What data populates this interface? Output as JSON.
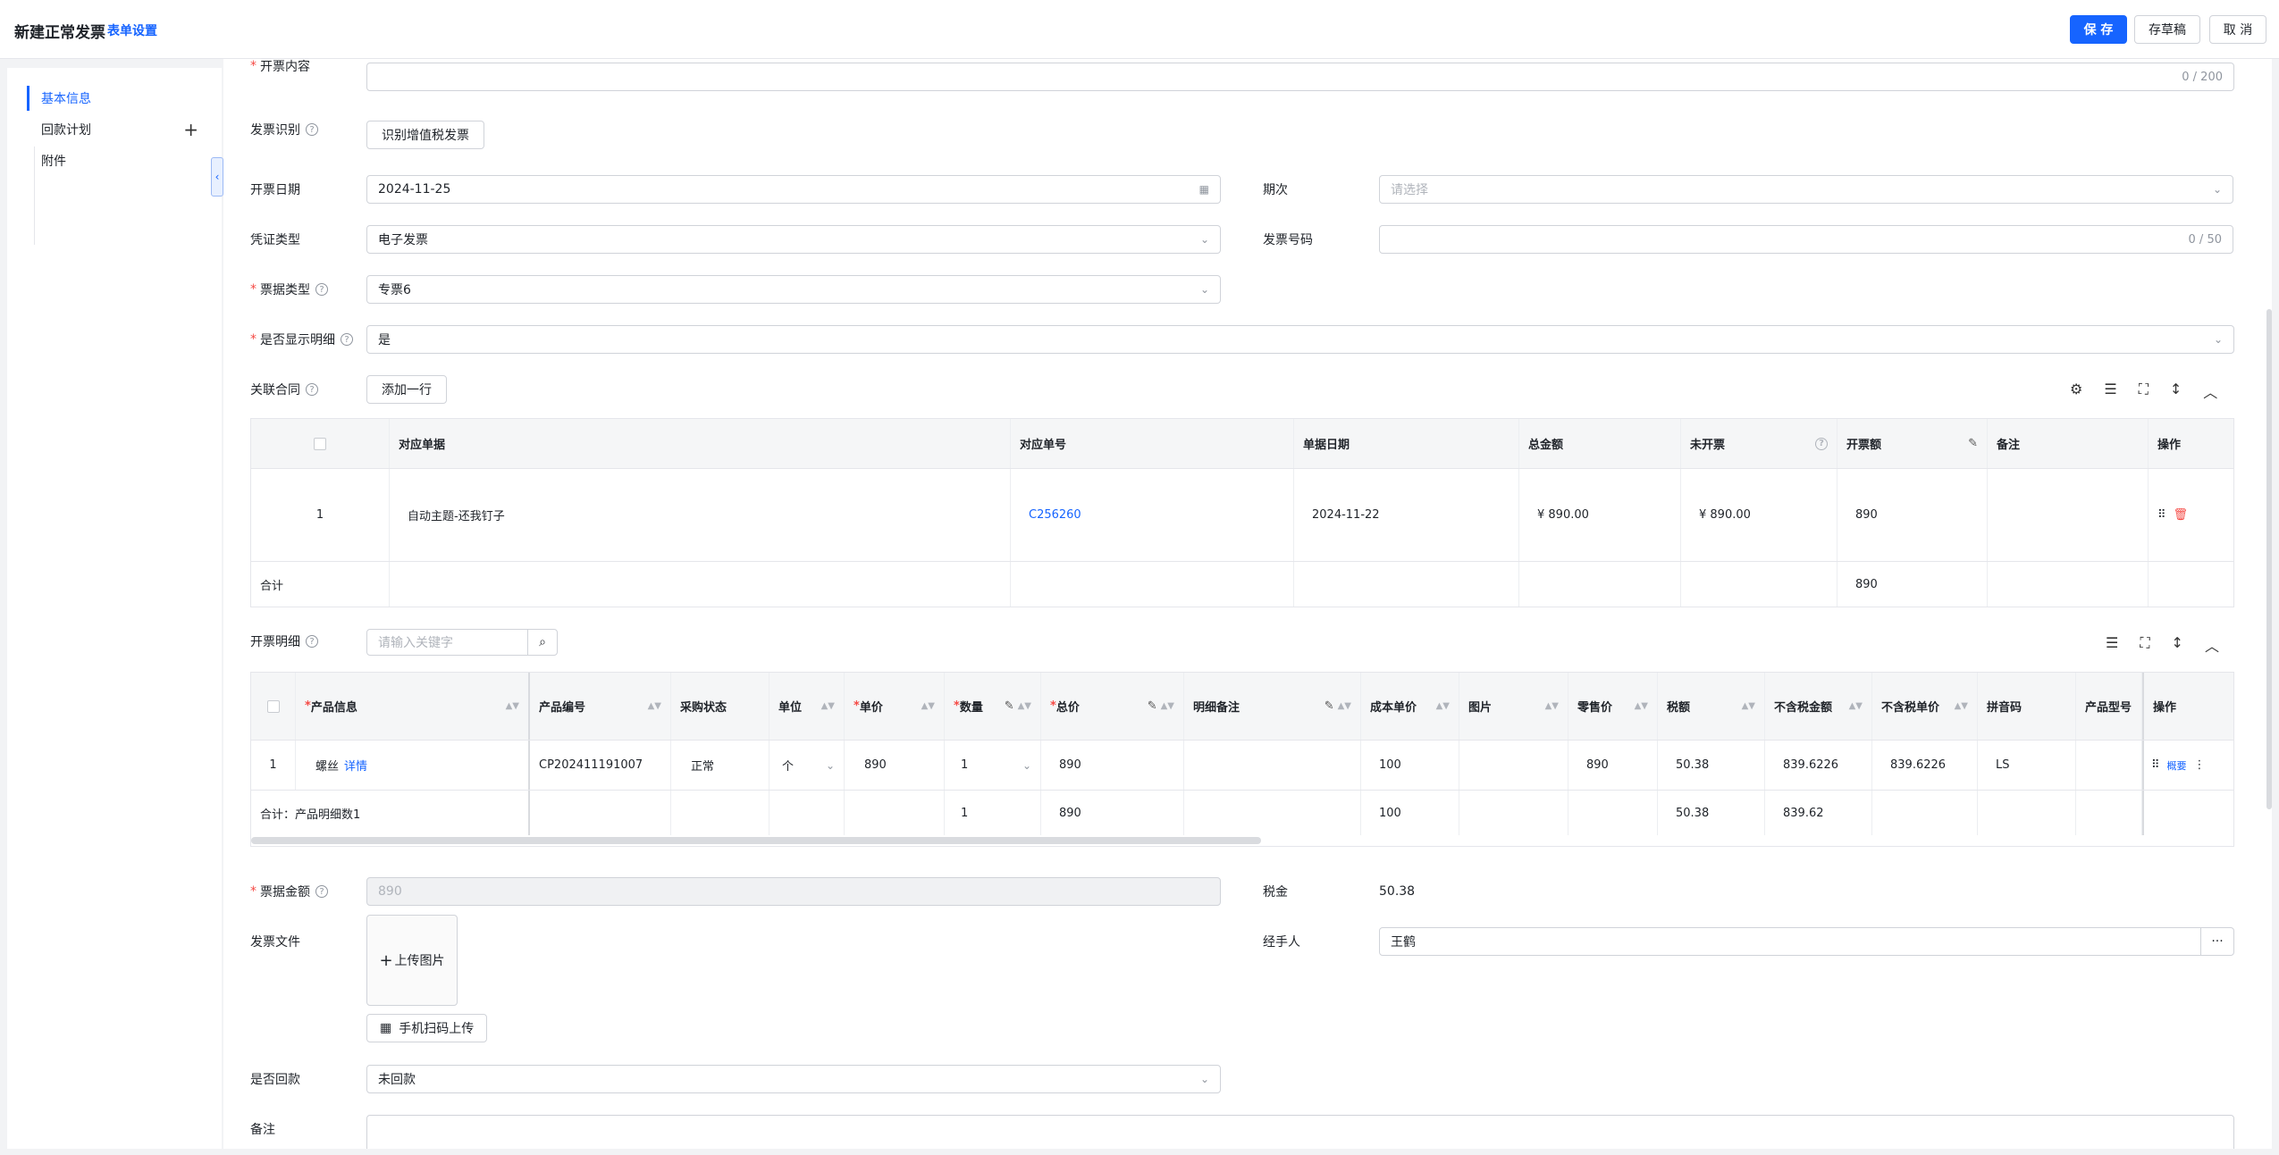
{
  "header": {
    "title": "新建正常发票",
    "form_settings": "表单设置",
    "save": "保 存",
    "draft": "存草稿",
    "cancel": "取 消"
  },
  "sidebar": {
    "items": [
      {
        "label": "基本信息"
      },
      {
        "label": "回款计划"
      },
      {
        "label": "附件"
      }
    ]
  },
  "form": {
    "content_label": "开票内容",
    "content_counter": "0 / 200",
    "recognize_label": "发票识别",
    "recognize_button": "识别增值税发票",
    "date_label": "开票日期",
    "date_value": "2024-11-25",
    "period_label": "期次",
    "period_placeholder": "请选择",
    "voucher_label": "凭证类型",
    "voucher_value": "电子发票",
    "invoice_no_label": "发票号码",
    "invoice_no_counter": "0 / 50",
    "bill_type_label": "票据类型",
    "bill_type_value": "专票6",
    "show_detail_label": "是否显示明细",
    "show_detail_value": "是",
    "contract_label": "关联合同",
    "add_row_button": "添加一行",
    "detail_label": "开票明细",
    "detail_search_placeholder": "请输入关键字",
    "amount_label": "票据金额",
    "amount_value": "890",
    "tax_label": "税金",
    "tax_value": "50.38",
    "file_label": "发票文件",
    "upload_label": "上传图片",
    "scan_upload_label": "手机扫码上传",
    "handler_label": "经手人",
    "handler_value": "王鹤",
    "returned_label": "是否回款",
    "returned_value": "未回款",
    "remark_label": "备注"
  },
  "contract_table": {
    "headers": [
      "对应单据",
      "对应单号",
      "单据日期",
      "总金额",
      "未开票",
      "开票额",
      "备注",
      "操作"
    ],
    "row": {
      "index": "1",
      "doc": "自动主题-还我钉子",
      "no": "C256260",
      "date": "2024-11-22",
      "total": "¥ 890.00",
      "unbilled": "¥ 890.00",
      "billed": "890"
    },
    "total_label": "合计",
    "total_billed": "890"
  },
  "detail_table": {
    "headers": [
      "产品信息",
      "产品编号",
      "采购状态",
      "单位",
      "单价",
      "数量",
      "总价",
      "明细备注",
      "成本单价",
      "图片",
      "零售价",
      "税额",
      "不含税金额",
      "不含税单价",
      "拼音码",
      "产品型号",
      "操作"
    ],
    "row": {
      "index": "1",
      "product": "螺丝",
      "detail_link": "详情",
      "code": "CP202411191007",
      "status": "正常",
      "unit": "个",
      "price": "890",
      "qty": "1",
      "total": "890",
      "cost": "100",
      "retail": "890",
      "tax": "50.38",
      "net_amount": "839.6226",
      "net_price": "839.6226",
      "pinyin": "LS",
      "op_link": "概要"
    },
    "summary": {
      "label": "合计：产品明细数1",
      "qty": "1",
      "total": "890",
      "cost": "100",
      "tax": "50.38",
      "net_amount": "839.62"
    }
  }
}
